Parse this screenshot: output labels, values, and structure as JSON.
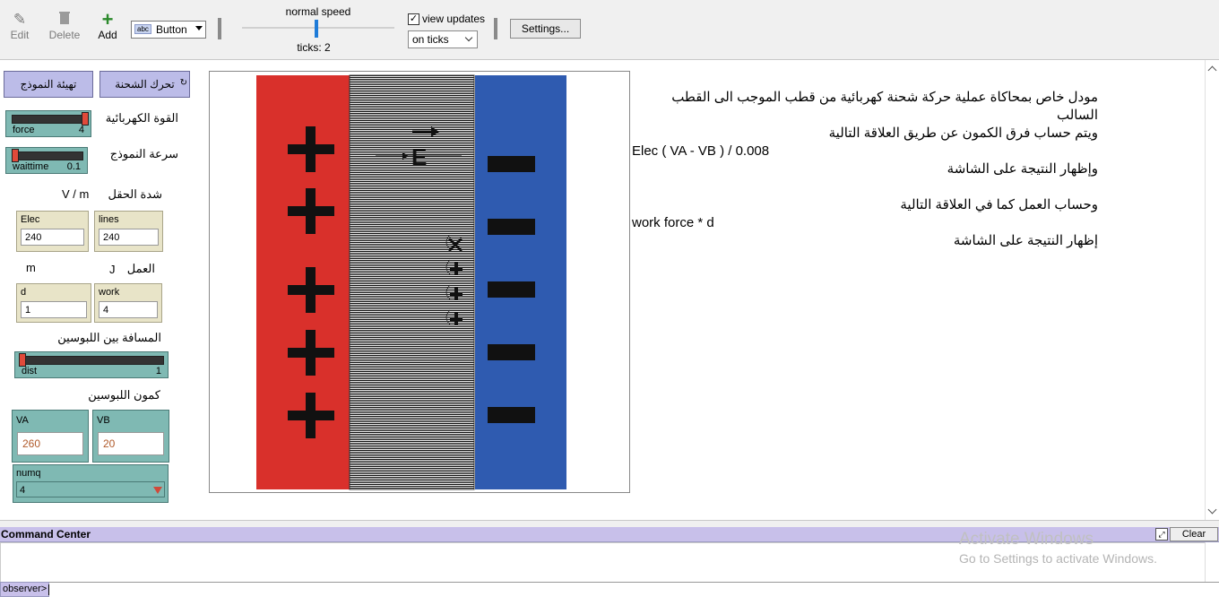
{
  "toolbar": {
    "edit_label": "Edit",
    "delete_label": "Delete",
    "add_label": "Add",
    "widget_type": "Button",
    "widget_icon_text": "abc",
    "speed_label": "normal speed",
    "speed_level": 0.5,
    "ticks_label": "ticks: 2",
    "view_updates_label": "view updates",
    "view_updates_checked": "✓",
    "update_mode": "on ticks",
    "settings_label": "Settings..."
  },
  "interface": {
    "setup_button": "تهيئة النموذج",
    "go_button": "تحرك الشحنة",
    "force_label": "القوة الكهربائية",
    "force_slider": {
      "name": "force",
      "value": "4",
      "level": 1.0
    },
    "speed_label": "سرعة النموذج",
    "waittime_slider": {
      "name": "waittime",
      "value": "0.1",
      "level": 0.0
    },
    "field_label": "شدة الحقل",
    "field_units": "V / m",
    "elec_monitor": {
      "name": "Elec",
      "value": "240"
    },
    "lines_monitor": {
      "name": "lines",
      "value": "240"
    },
    "work_label": "العمل",
    "work_units": "J",
    "distance_units": "m",
    "d_monitor": {
      "name": "d",
      "value": "1"
    },
    "work_monitor": {
      "name": "work",
      "value": "4"
    },
    "dist_label": "المسافة بين اللبوسين",
    "dist_slider": {
      "name": "dist",
      "value": "1",
      "level": 0.0
    },
    "potential_label": "كمون اللبوسين",
    "va_input": {
      "name": "VA",
      "value": "260"
    },
    "vb_input": {
      "name": "VB",
      "value": "20"
    },
    "numq_chooser": {
      "name": "numq",
      "value": "4"
    }
  },
  "world": {
    "field_symbol": "E",
    "plus_color": "#d9302b",
    "minus_color": "#2f5bb0"
  },
  "info_text": {
    "line1": "مودل خاص بمحاكاة عملية حركة شحنة كهربائية من قطب الموجب الى القطب",
    "line2": "السالب",
    "line3": "ويتم حساب فرق الكمون عن طريق العلاقة التالية",
    "line4": "Elec ( VA - VB ) / 0.008",
    "line5": "وإظهار النتيجة على الشاشة",
    "line6": "وحساب العمل كما في العلاقة التالية",
    "line7": "work force * d",
    "line8": "إظهار النتيجة على الشاشة"
  },
  "command_center": {
    "title": "Command Center",
    "clear_label": "Clear",
    "prompt": "observer>"
  },
  "watermark": {
    "line1": "Activate Windows",
    "line2": "Go to Settings to activate Windows."
  }
}
